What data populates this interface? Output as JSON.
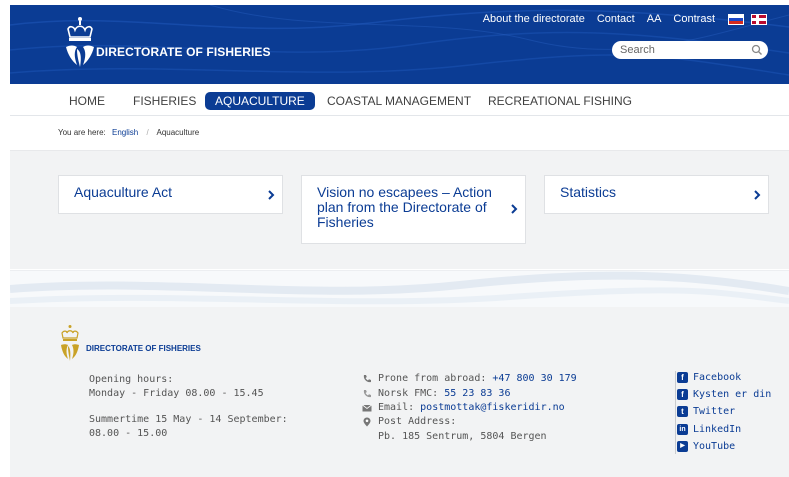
{
  "header": {
    "logo_text": "DIRECTORATE OF FISHERIES",
    "top_links": [
      "About the directorate",
      "Contact",
      "AA",
      "Contrast"
    ],
    "search_placeholder": "Search"
  },
  "nav": {
    "items": [
      "HOME",
      "FISHERIES",
      "AQUACULTURE",
      "COASTAL MANAGEMENT",
      "RECREATIONAL FISHING"
    ],
    "active": "AQUACULTURE"
  },
  "breadcrumb": {
    "prefix": "You are here:",
    "items": [
      "English",
      "Aquaculture"
    ]
  },
  "cards": [
    {
      "title_lines": [
        "Aquaculture Act"
      ]
    },
    {
      "title_lines": [
        "Vision no escapees – Action",
        "plan from the Directorate of",
        "Fisheries"
      ]
    },
    {
      "title_lines": [
        "Statistics"
      ]
    }
  ],
  "footer": {
    "logo_text": "DIRECTORATE OF FISHERIES",
    "opening_hours_label": "Opening hours:",
    "opening_hours_value": "Monday - Friday 08.00 - 15.45",
    "summertime_label": "Summertime 15 May - 14 September:",
    "summertime_value": "08.00 - 15.00",
    "phone_label": "Prone from abroad:",
    "phone_value": "+47 800 30 179",
    "fmc_label": "Norsk FMC:",
    "fmc_value": "55 23 83 36",
    "email_label": "Email:",
    "email_value": "postmottak@fiskeridir.no",
    "post_label": "Post Address:",
    "post_value": "Pb. 185 Sentrum, 5804 Bergen",
    "social": [
      {
        "icon": "facebook-icon",
        "glyph": "f",
        "label": "Facebook"
      },
      {
        "icon": "facebook-icon",
        "glyph": "f",
        "label": "Kysten er din"
      },
      {
        "icon": "twitter-icon",
        "glyph": "t",
        "label": "Twitter"
      },
      {
        "icon": "linkedin-icon",
        "glyph": "in",
        "label": "LinkedIn"
      },
      {
        "icon": "youtube-icon",
        "glyph": "▶",
        "label": "YouTube"
      }
    ]
  },
  "colors": {
    "brand_blue": "#0b3c94",
    "gold": "#c9a227"
  }
}
